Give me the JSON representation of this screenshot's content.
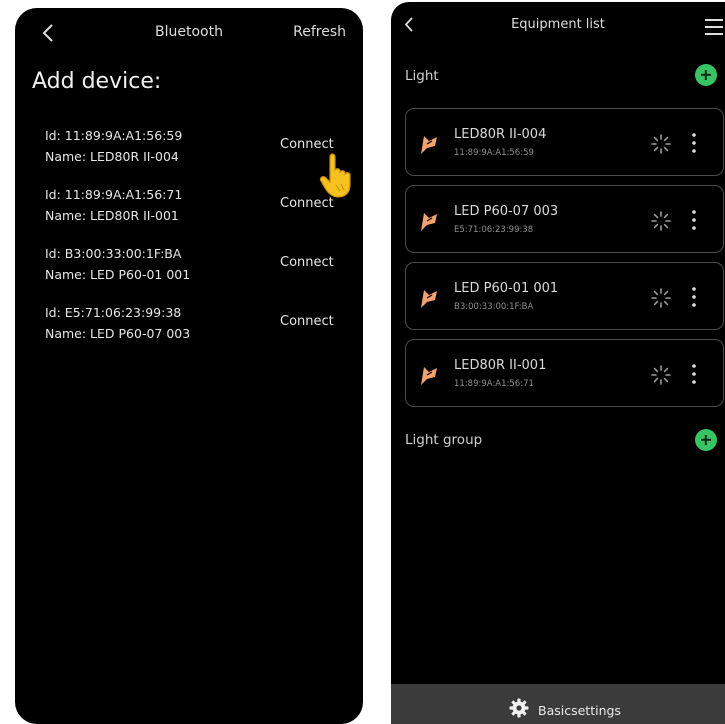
{
  "left_screen": {
    "title": "Bluetooth",
    "refresh_label": "Refresh",
    "heading": "Add device:",
    "devices": [
      {
        "id_text": "Id: 11:89:9A:A1:56:59",
        "name_text": "Name: LED80R II-004",
        "connect_label": "Connect"
      },
      {
        "id_text": "Id: 11:89:9A:A1:56:71",
        "name_text": "Name: LED80R II-001",
        "connect_label": "Connect"
      },
      {
        "id_text": "Id: B3:00:33:00:1F:BA",
        "name_text": "Name: LED P60-01 001",
        "connect_label": "Connect"
      },
      {
        "id_text": "Id: E5:71:06:23:99:38",
        "name_text": "Name: LED P60-07 003",
        "connect_label": "Connect"
      }
    ]
  },
  "right_screen": {
    "title": "Equipment list",
    "light_label": "Light",
    "light_group_label": "Light group",
    "lights": [
      {
        "name": "LED80R II-004",
        "id": "11:89:9A:A1:56:59"
      },
      {
        "name": "LED P60-07 003",
        "id": "E5:71:06:23:99:38"
      },
      {
        "name": "LED P60-01 001",
        "id": "B3:00:33:00:1F:BA"
      },
      {
        "name": "LED80R II-001",
        "id": "11:89:9A:A1:56:71"
      }
    ],
    "footer_label": "Basicsettings"
  },
  "colors": {
    "accent_green": "#37c463",
    "lamp_orange": "#f2a26a",
    "hand_yellow": "#f7c21e"
  },
  "icons": [
    "back-icon",
    "hand-pointer-icon",
    "menu-icon",
    "add-icon",
    "lamp-icon",
    "loading-spinner-icon",
    "more-vertical-icon",
    "gear-icon"
  ]
}
